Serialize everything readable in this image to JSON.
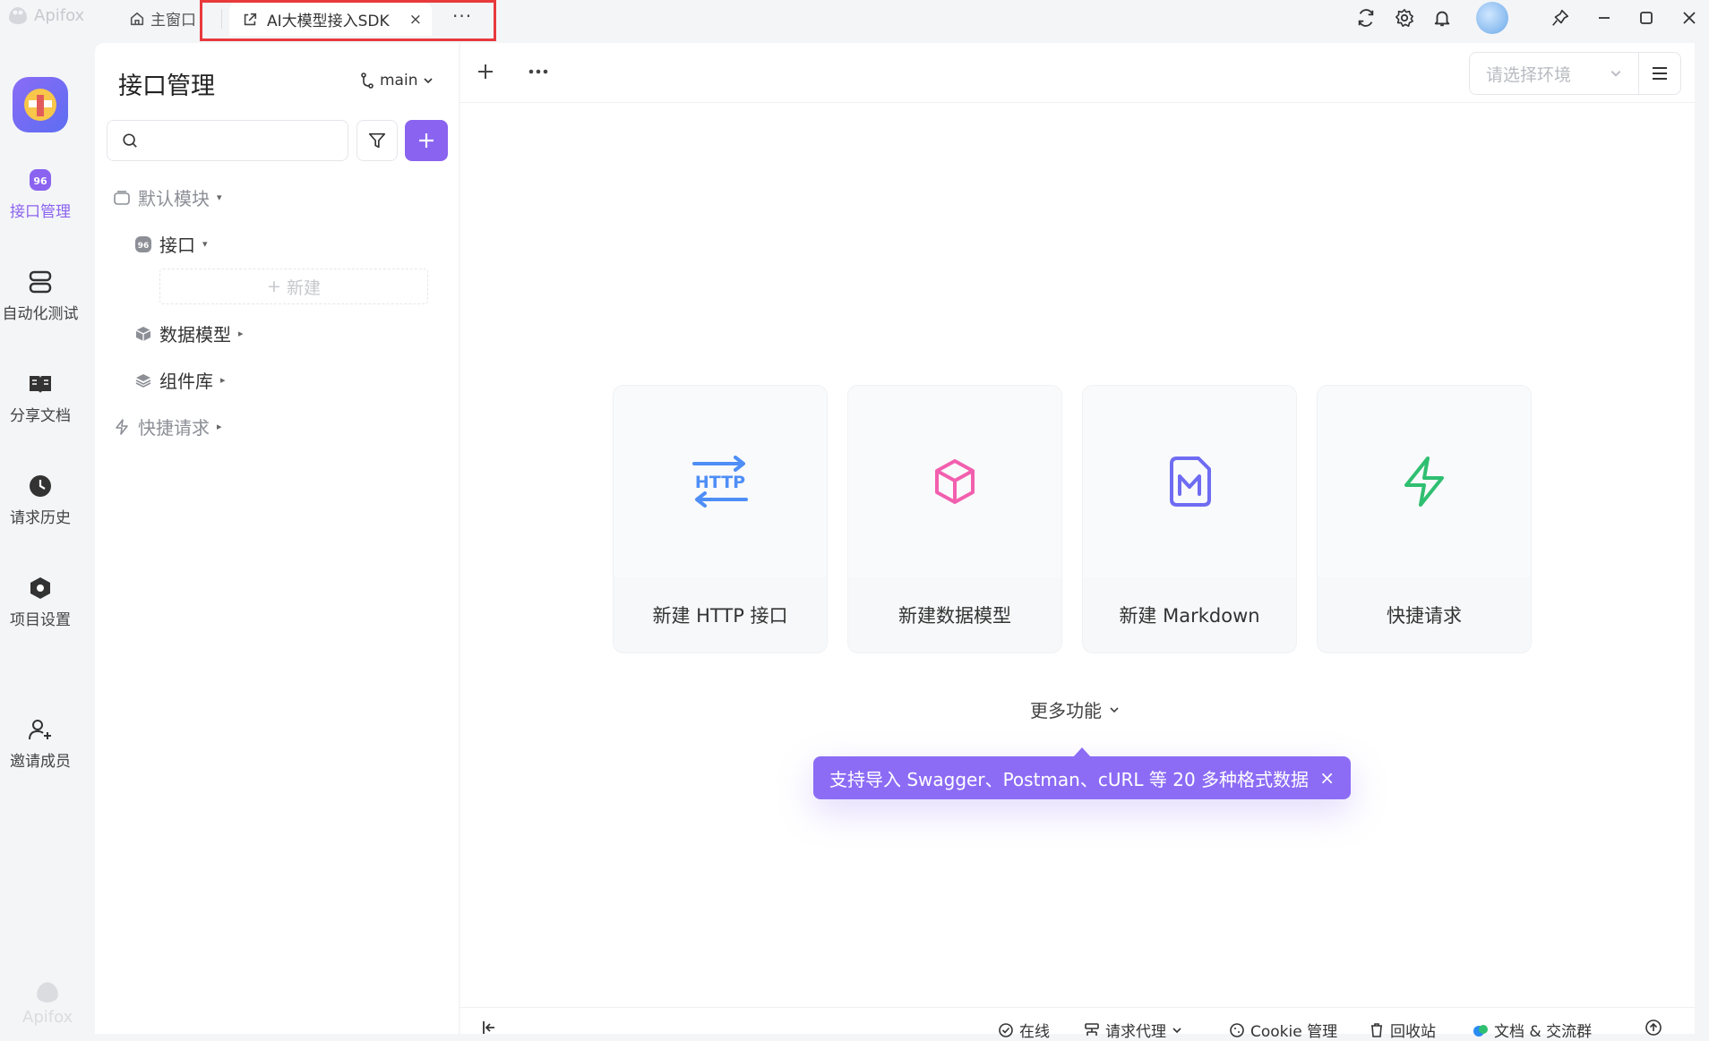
{
  "titlebar": {
    "app_name": "Apifox",
    "home_tab_label": "主窗口",
    "active_tab_label": "AI大模型接入SDK",
    "tab_close": "×",
    "tab_more": "···"
  },
  "rail": {
    "items": [
      {
        "label": "接口管理",
        "icon": "api-icon",
        "active": true
      },
      {
        "label": "自动化测试",
        "icon": "automation-icon"
      },
      {
        "label": "分享文档",
        "icon": "book-icon"
      },
      {
        "label": "请求历史",
        "icon": "clock-icon"
      },
      {
        "label": "项目设置",
        "icon": "settings-hex-icon"
      },
      {
        "label": "邀请成员",
        "icon": "add-user-icon"
      }
    ],
    "bottom_logo": "Apifox"
  },
  "panel": {
    "title": "接口管理",
    "branch": "main",
    "search_placeholder": "",
    "tree": {
      "module": "默认模块",
      "api": "接口",
      "new_label": "新建",
      "data_model": "数据模型",
      "components": "组件库",
      "quick_request": "快捷请求"
    }
  },
  "main": {
    "env_placeholder": "请选择环境",
    "cards": [
      {
        "label": "新建 HTTP 接口",
        "icon": "http-icon"
      },
      {
        "label": "新建数据模型",
        "icon": "cube-icon"
      },
      {
        "label": "新建 Markdown",
        "icon": "markdown-icon"
      },
      {
        "label": "快捷请求",
        "icon": "lightning-icon"
      }
    ],
    "more_functions": "更多功能",
    "tooltip": "支持导入 Swagger、Postman、cURL 等 20 多种格式数据",
    "tooltip_close": "×"
  },
  "statusbar": {
    "online": "在线",
    "proxy": "请求代理",
    "cookie": "Cookie 管理",
    "recycle": "回收站",
    "docs": "文档 & 交流群"
  },
  "colors": {
    "accent": "#8a63f0",
    "http_blue": "#4e8ef7",
    "cube_pink": "#f25fae",
    "markdown_purple": "#6f6cf3",
    "lightning_green": "#2fbf71",
    "highlight_red": "#e8393b"
  }
}
